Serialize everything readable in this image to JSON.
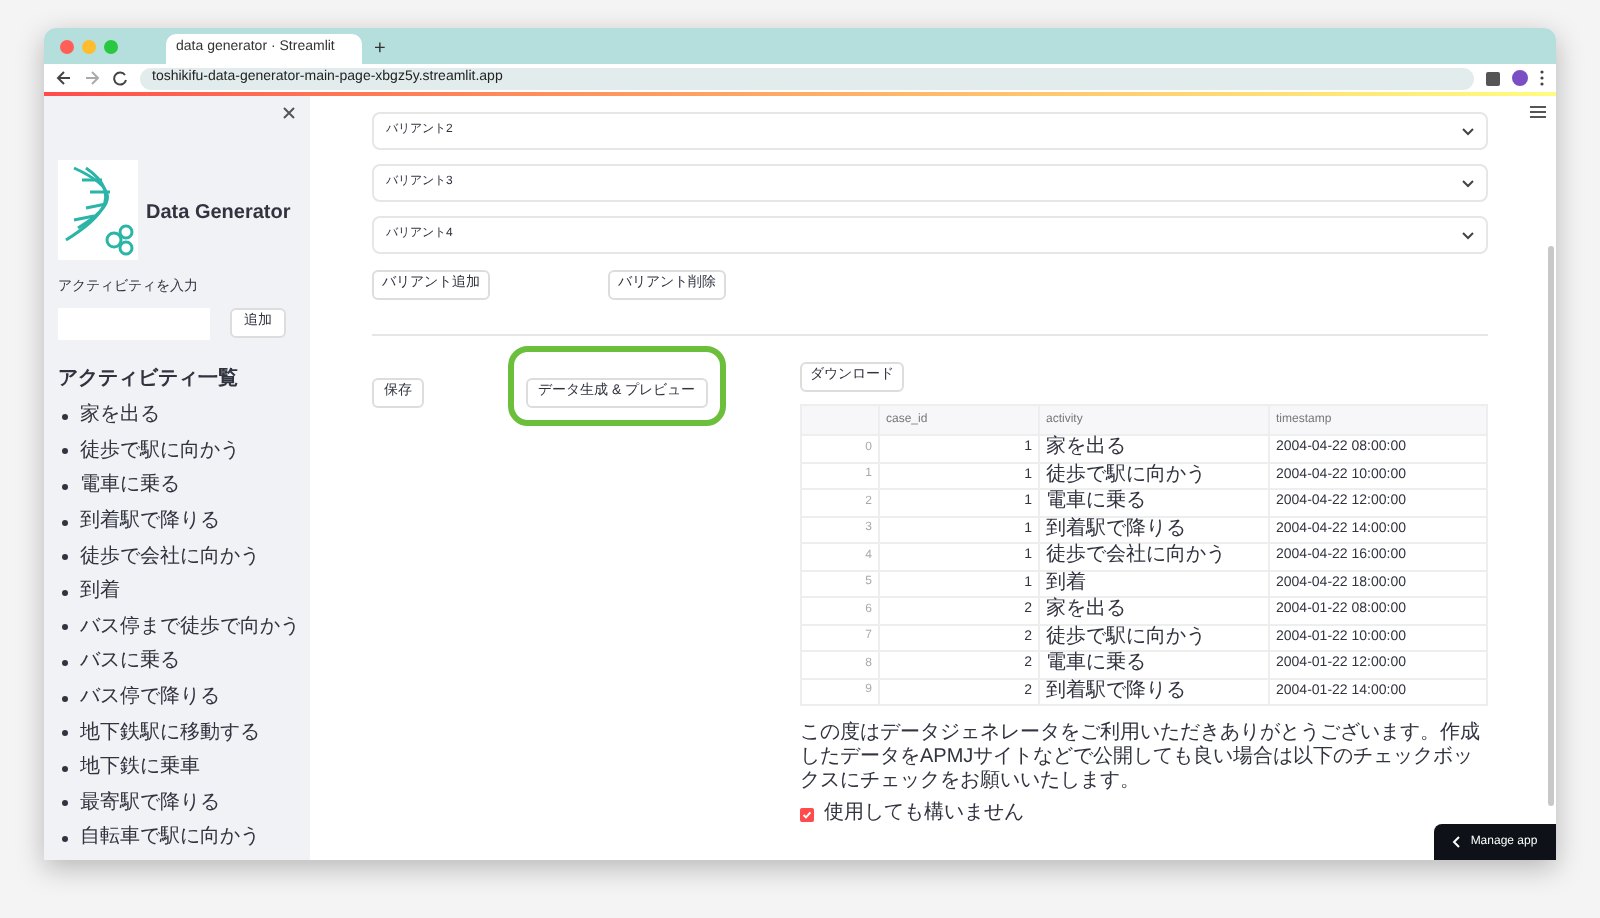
{
  "browser": {
    "tab_title": "data generator · Streamlit",
    "new_tab": "+",
    "url": "toshikifu-data-generator-main-page-xbgz5y.streamlit.app"
  },
  "sidebar": {
    "app_title": "Data Generator",
    "input_label": "アクティビティを入力",
    "add_button": "追加",
    "list_heading": "アクティビティ一覧",
    "items": [
      "家を出る",
      "徒歩で駅に向かう",
      "電車に乗る",
      "到着駅で降りる",
      "徒歩で会社に向かう",
      "到着",
      "バス停まで徒歩で向かう",
      "バスに乗る",
      "バス停で降りる",
      "地下鉄駅に移動する",
      "地下鉄に乗車",
      "最寄駅で降りる",
      "自転車で駅に向かう"
    ]
  },
  "expanders": [
    {
      "label": "バリアント2",
      "expanded": false
    },
    {
      "label": "バリアント3",
      "expanded": false
    },
    {
      "label": "バリアント4",
      "expanded": false
    }
  ],
  "variant_buttons": [
    "バリアント追加",
    "バリアント削除"
  ],
  "action_buttons": [
    {
      "label": "保存",
      "highlighted": false
    },
    {
      "label": "データ生成 & プレビュー",
      "highlighted": true
    }
  ],
  "download_button": "ダウンロード",
  "table": {
    "columns": [
      "",
      "case_id",
      "activity",
      "timestamp"
    ],
    "rows": [
      [
        "0",
        "1",
        "家を出る",
        "2004-04-22 08:00:00"
      ],
      [
        "1",
        "1",
        "徒歩で駅に向かう",
        "2004-04-22 10:00:00"
      ],
      [
        "2",
        "1",
        "電車に乗る",
        "2004-04-22 12:00:00"
      ],
      [
        "3",
        "1",
        "到着駅で降りる",
        "2004-04-22 14:00:00"
      ],
      [
        "4",
        "1",
        "徒歩で会社に向かう",
        "2004-04-22 16:00:00"
      ],
      [
        "5",
        "1",
        "到着",
        "2004-04-22 18:00:00"
      ],
      [
        "6",
        "2",
        "家を出る",
        "2004-01-22 08:00:00"
      ],
      [
        "7",
        "2",
        "徒歩で駅に向かう",
        "2004-01-22 10:00:00"
      ],
      [
        "8",
        "2",
        "電車に乗る",
        "2004-01-22 12:00:00"
      ],
      [
        "9",
        "2",
        "到着駅で降りる",
        "2004-01-22 14:00:00"
      ]
    ]
  },
  "notice": "この度はデータジェネレータをご利用いただきありがとうございます。作成したデータをAPMJサイトなどで公開しても良い場合は以下のチェックボックスにチェックをお願いいたします。",
  "consent": {
    "label": "使用しても構いません",
    "checked": true
  },
  "manage_app": "Manage app"
}
